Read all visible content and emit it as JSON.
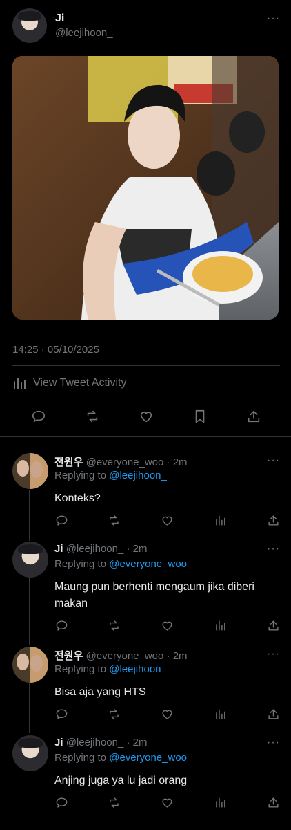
{
  "tweet": {
    "author_name": "Ji",
    "author_handle": "@leejihoon_",
    "more_label": "···",
    "timestamp": "14:25 · 05/10/2025",
    "activity_label": "View Tweet Activity",
    "icons": [
      "reply-icon",
      "retweet-icon",
      "like-icon",
      "bookmark-icon",
      "share-icon"
    ]
  },
  "replies": [
    {
      "name": "전원우",
      "handle": "@everyone_woo",
      "time": "· 2m",
      "replying_prefix": "Replying to ",
      "replying_to": "@leejihoon_",
      "text": "Konteks?"
    },
    {
      "name": "Ji",
      "handle": "@leejihoon_",
      "time": "· 2m",
      "replying_prefix": "Replying to ",
      "replying_to": "@everyone_woo",
      "text": "Maung pun berhenti mengaum jika diberi makan"
    },
    {
      "name": "전원우",
      "handle": "@everyone_woo",
      "time": "· 2m",
      "replying_prefix": "Replying to ",
      "replying_to": "@leejihoon_",
      "text": "Bisa aja yang HTS"
    },
    {
      "name": "Ji",
      "handle": "@leejihoon_",
      "time": "· 2m",
      "replying_prefix": "Replying to ",
      "replying_to": "@everyone_woo",
      "text": "Anjing juga ya lu jadi orang"
    }
  ],
  "colors": {
    "background": "#000000",
    "text": "#e7e9ea",
    "secondary": "#71767b",
    "link": "#1d9bf0",
    "divider": "#2f3336"
  }
}
